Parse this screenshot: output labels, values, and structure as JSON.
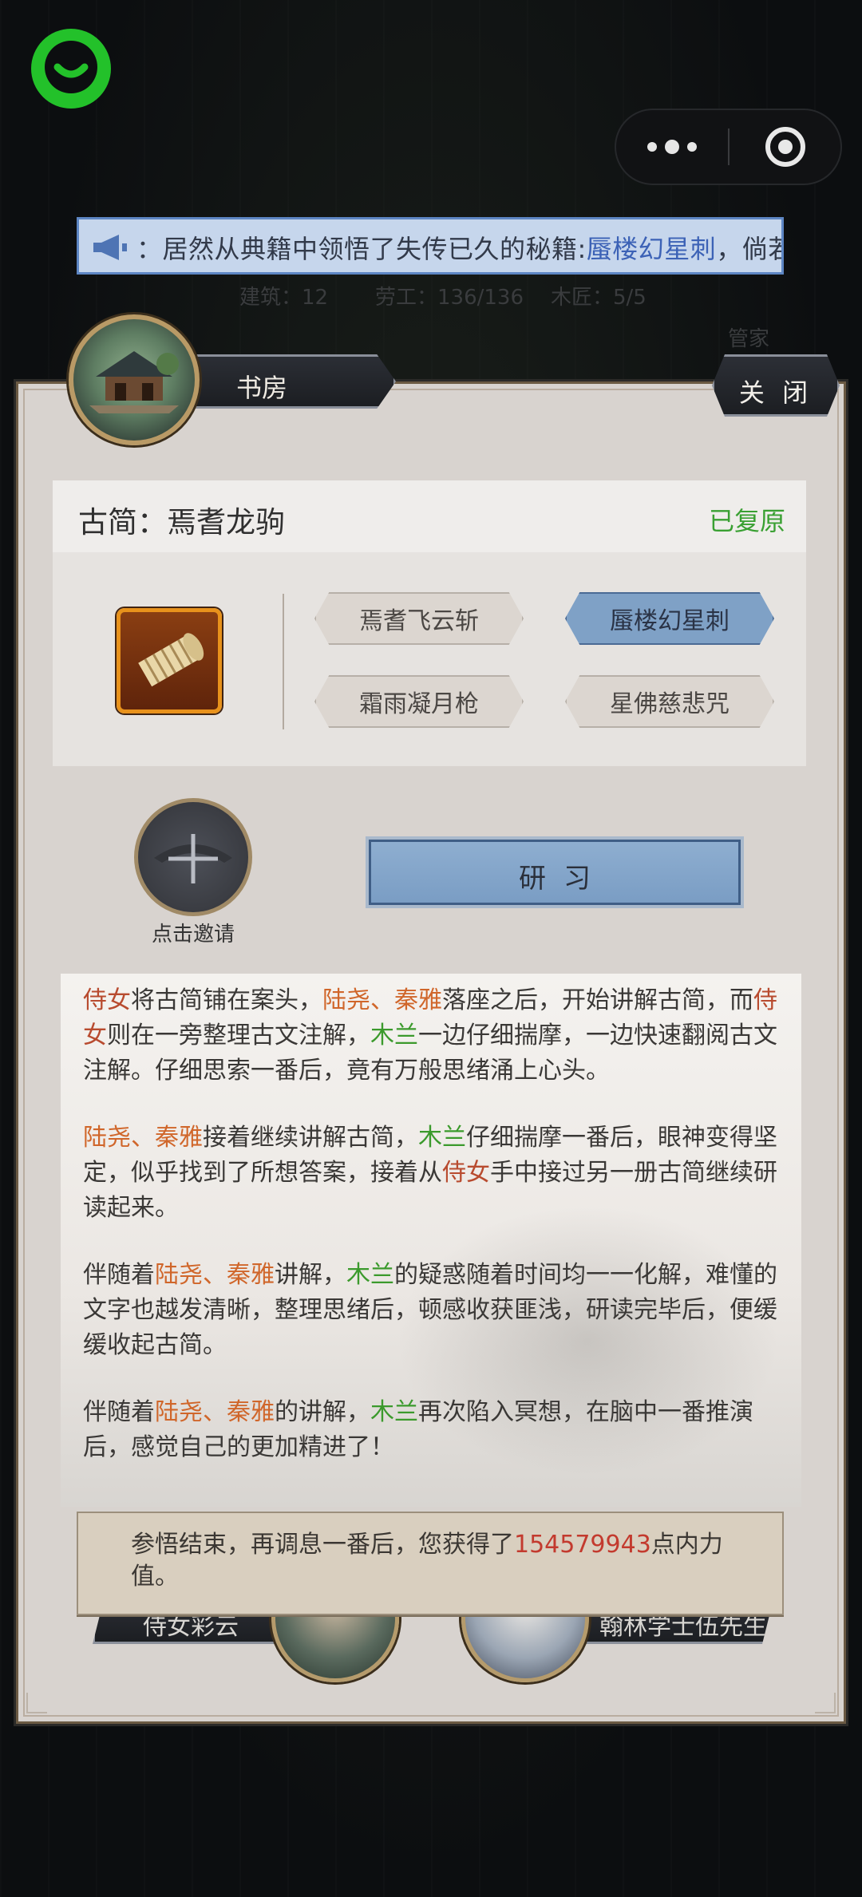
{
  "ticker": {
    "text_prefix": "：居然从典籍中领悟了失传已久的秘籍:",
    "highlight": "蜃楼幻星刺",
    "text_suffix": "，倘若他"
  },
  "background_hud": {
    "stats_1": "建筑：12",
    "stats_2": "劳工：136/136",
    "stats_3": "木匠：5/5",
    "side_label": "管家"
  },
  "panel": {
    "title": "书房",
    "close_label": "关 闭"
  },
  "scroll_card": {
    "title": "古简：焉耆龙驹",
    "status": "已复原",
    "skills": [
      "焉耆飞云斩",
      "蜃楼幻星刺",
      "霜雨凝月枪",
      "星佛慈悲咒"
    ],
    "active_skill_index": 1
  },
  "invite": {
    "label": "点击邀请"
  },
  "study_button": {
    "label": "研习"
  },
  "story": {
    "p1": [
      {
        "t": "侍女",
        "c": "r"
      },
      {
        "t": "将古简铺在案头，",
        "c": ""
      },
      {
        "t": "陆尧、秦雅",
        "c": "o"
      },
      {
        "t": "落座之后，开始讲解古简，而",
        "c": ""
      },
      {
        "t": "侍女",
        "c": "r"
      },
      {
        "t": "则在一旁整理古文注解，",
        "c": ""
      },
      {
        "t": "木兰",
        "c": "g"
      },
      {
        "t": "一边仔细揣摩，一边快速翻阅古文注解。仔细思索一番后，竟有万般思绪涌上心头。",
        "c": ""
      }
    ],
    "p2": [
      {
        "t": "陆尧、秦雅",
        "c": "o"
      },
      {
        "t": "接着继续讲解古简，",
        "c": ""
      },
      {
        "t": "木兰",
        "c": "g"
      },
      {
        "t": "仔细揣摩一番后，眼神变得坚定，似乎找到了所想答案，接着从",
        "c": ""
      },
      {
        "t": "侍女",
        "c": "r"
      },
      {
        "t": "手中接过另一册古简继续研读起来。",
        "c": ""
      }
    ],
    "p3": [
      {
        "t": "伴随着",
        "c": ""
      },
      {
        "t": "陆尧、秦雅",
        "c": "o"
      },
      {
        "t": "讲解，",
        "c": ""
      },
      {
        "t": "木兰",
        "c": "g"
      },
      {
        "t": "的疑惑随着时间均一一化解，难懂的文字也越发清晰，整理思绪后，顿感收获匪浅，研读完毕后，便缓缓收起古简。",
        "c": ""
      }
    ],
    "p4": [
      {
        "t": "伴随着",
        "c": ""
      },
      {
        "t": "陆尧、秦雅",
        "c": "o"
      },
      {
        "t": "的讲解，",
        "c": ""
      },
      {
        "t": "木兰",
        "c": "g"
      },
      {
        "t": "再次陷入冥想，在脑中一番推演后，感觉自己的更加精进了！",
        "c": ""
      }
    ]
  },
  "result": {
    "prefix": "参悟结束，再调息一番后，您获得了",
    "amount": "154579943",
    "suffix": "点内力值。"
  },
  "characters": {
    "left_name": "侍女彩云",
    "right_name": "翰林学士伍先生"
  },
  "colors": {
    "accent_blue": "#7fa1c6",
    "status_green": "#39a032",
    "name_red": "#b84b2f",
    "name_orange": "#d0662a",
    "name_green": "#3b9a2c",
    "number_red": "#c33a2e"
  }
}
